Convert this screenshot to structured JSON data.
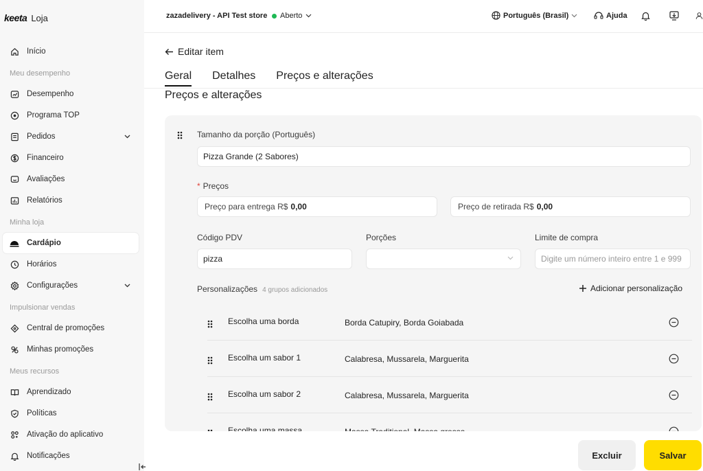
{
  "brand": {
    "logo": "keeta",
    "name": "Loja"
  },
  "sidebar": {
    "items": [
      {
        "type": "item",
        "label": "Início",
        "icon": "home-icon"
      },
      {
        "type": "section",
        "label": "Meu desempenho"
      },
      {
        "type": "item",
        "label": "Desempenho",
        "icon": "performance-icon"
      },
      {
        "type": "item",
        "label": "Programa TOP",
        "icon": "top-program-icon"
      },
      {
        "type": "item",
        "label": "Pedidos",
        "icon": "orders-icon",
        "expandable": true
      },
      {
        "type": "item",
        "label": "Financeiro",
        "icon": "money-icon"
      },
      {
        "type": "item",
        "label": "Avaliações",
        "icon": "reviews-icon"
      },
      {
        "type": "item",
        "label": "Relatórios",
        "icon": "reports-icon"
      },
      {
        "type": "section",
        "label": "Minha loja"
      },
      {
        "type": "item",
        "label": "Cardápio",
        "icon": "menu-icon",
        "active": true
      },
      {
        "type": "item",
        "label": "Horários",
        "icon": "clock-icon"
      },
      {
        "type": "item",
        "label": "Configurações",
        "icon": "settings-icon",
        "expandable": true
      },
      {
        "type": "section",
        "label": "Impulsionar vendas"
      },
      {
        "type": "item",
        "label": "Central de promoções",
        "icon": "promo-center-icon"
      },
      {
        "type": "item",
        "label": "Minhas promoções",
        "icon": "my-promos-icon"
      },
      {
        "type": "section",
        "label": "Meus recursos"
      },
      {
        "type": "item",
        "label": "Aprendizado",
        "icon": "book-icon"
      },
      {
        "type": "item",
        "label": "Políticas",
        "icon": "shield-icon"
      },
      {
        "type": "item",
        "label": "Ativação do aplicativo",
        "icon": "app-grid-icon"
      },
      {
        "type": "item",
        "label": "Notificações",
        "icon": "bell-icon"
      }
    ]
  },
  "topbar": {
    "store_name": "zazadelivery - API Test store",
    "status": "Aberto",
    "status_color": "#1db954",
    "language": "Português (Brasil)",
    "help": "Ajuda"
  },
  "page": {
    "back_label": "Editar item",
    "tabs": [
      "Geral",
      "Detalhes",
      "Preços e alterações"
    ],
    "active_tab": "Geral",
    "section_title": "Preços e alterações"
  },
  "form": {
    "portion_label": "Tamanho da porção (Português)",
    "portion_value": "Pizza Grande (2 Sabores)",
    "prices_label": "Preços",
    "delivery_price_label": "Preço para entrega R$",
    "delivery_price_value": "0,00",
    "pickup_price_label": "Preço de retirada R$",
    "pickup_price_value": "0,00",
    "pdv_label": "Código PDV",
    "pdv_value": "pizza",
    "portions_label": "Porções",
    "portions_value": "",
    "limit_label": "Limite de compra",
    "limit_placeholder": "Digite um número inteiro entre 1 e 999"
  },
  "customizations": {
    "title": "Personalizações",
    "count_text": "4 grupos adicionados",
    "add_label": "Adicionar personalização",
    "groups": [
      {
        "name": "Escolha uma borda",
        "options": "Borda Catupiry, Borda Goiabada"
      },
      {
        "name": "Escolha um sabor 1",
        "options": "Calabresa, Mussarela, Marguerita"
      },
      {
        "name": "Escolha um sabor 2",
        "options": "Calabresa, Mussarela, Marguerita"
      },
      {
        "name": "Escolha uma massa",
        "options": "Massa Traditional, Massa grossa"
      }
    ]
  },
  "actions": {
    "delete_label": "Excluir",
    "save_label": "Salvar",
    "save_color": "#ffdd00"
  }
}
